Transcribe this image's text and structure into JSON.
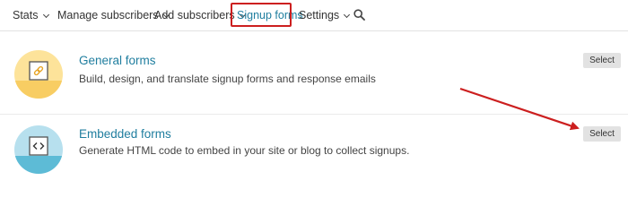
{
  "nav": {
    "items": [
      {
        "label": "Stats",
        "dropdown": true
      },
      {
        "label": "Manage subscribers",
        "dropdown": true
      },
      {
        "label": "Add subscribers",
        "dropdown": true
      },
      {
        "label": "Signup forms",
        "dropdown": false,
        "active": true
      },
      {
        "label": "Settings",
        "dropdown": true
      }
    ],
    "search_icon": "search-icon"
  },
  "forms": [
    {
      "title": "General forms",
      "description": "Build, design, and translate signup forms and response emails",
      "button_label": "Select",
      "icon": "link-icon",
      "icon_color": "#fde39a"
    },
    {
      "title": "Embedded forms",
      "description": "Generate HTML code to embed in your site or blog to collect signups.",
      "button_label": "Select",
      "icon": "code-icon",
      "icon_color": "#b7e0ee"
    }
  ],
  "colors": {
    "link": "#207e9f",
    "annotation": "#cc1f1f",
    "button_bg": "#e2e2e2"
  }
}
